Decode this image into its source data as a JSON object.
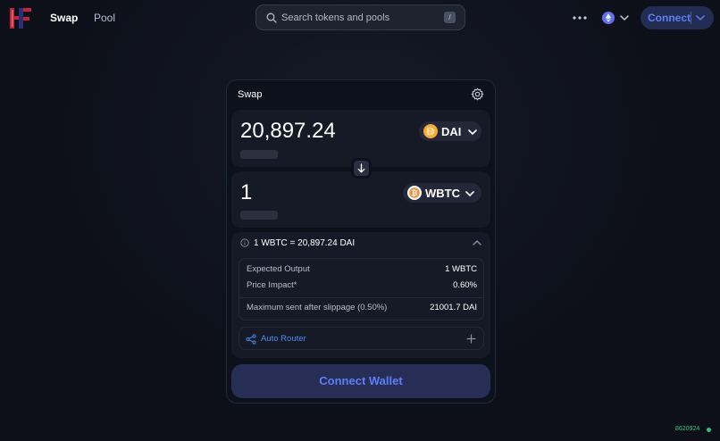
{
  "header": {
    "logo_icon": "hf-logo-icon",
    "nav": [
      {
        "label": "Swap",
        "active": true
      },
      {
        "label": "Pool",
        "active": false
      }
    ],
    "search": {
      "placeholder": "Search tokens and pools",
      "value": "",
      "shortcut": "/"
    },
    "more_icon": "more-dots-icon",
    "network_icon": "ethereum-icon",
    "connect_label": "Connect"
  },
  "swap": {
    "title": "Swap",
    "settings_icon": "gear-icon",
    "input": {
      "amount": "20,897.24",
      "token": "DAI",
      "token_icon": "dai-icon"
    },
    "output": {
      "amount": "1",
      "token": "WBTC",
      "token_icon": "wbtc-icon"
    },
    "switch_icon": "arrow-down-icon",
    "rate": "1 WBTC = 20,897.24 DAI",
    "details": {
      "expected_output_label": "Expected Output",
      "expected_output_value": "1 WBTC",
      "price_impact_label": "Price Impact*",
      "price_impact_value": "0.60%",
      "max_sent_label": "Maximum sent after slippage (0.50%)",
      "max_sent_value": "21001.7 DAI"
    },
    "router_label": "Auto Router",
    "connect_wallet_label": "Connect Wallet"
  },
  "footer": {
    "block_number": "8620924"
  },
  "colors": {
    "background": "#0d1019",
    "accent": "#5f7ef5",
    "router": "#4a8cf0",
    "status_green": "#2ec27a",
    "dai": "#f5ac37",
    "wbtc": "#f09242"
  }
}
